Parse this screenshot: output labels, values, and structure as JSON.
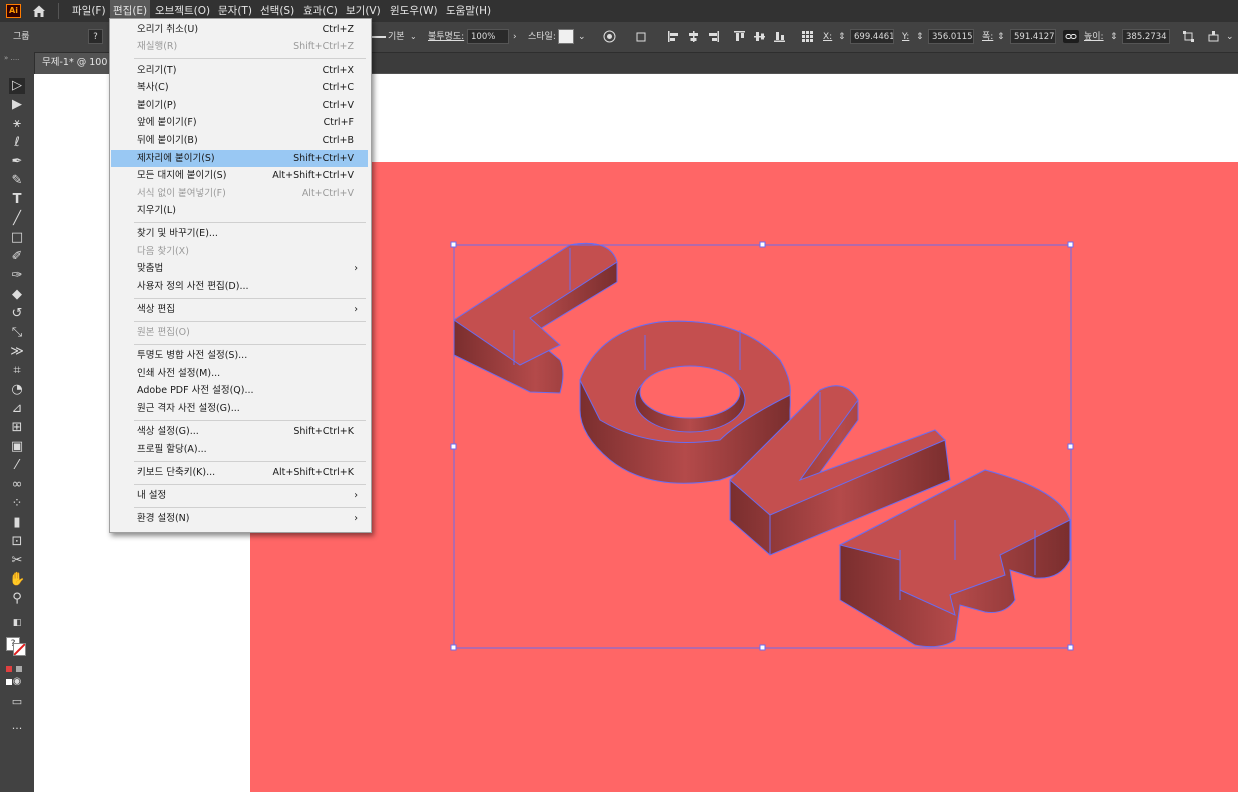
{
  "menubar": {
    "logo": "Ai",
    "items": [
      "파일(F)",
      "편집(E)",
      "오브젝트(O)",
      "문자(T)",
      "선택(S)",
      "효과(C)",
      "보기(V)",
      "윈도우(W)",
      "도움말(H)"
    ]
  },
  "controlbar": {
    "group_label": "그룹",
    "unknown_symbol": "?",
    "stroke_label": "기본",
    "opacity_label": "불투명도:",
    "opacity_value": "100%",
    "style_label": "스타일:",
    "x_label": "X:",
    "x_value": "699.4461 p",
    "y_label": "Y:",
    "y_value": "356.0115 p",
    "w_label": "폭:",
    "w_value": "591.4127 p",
    "h_label": "높이:",
    "h_value": "385.2734 p"
  },
  "document": {
    "tab_title": "무제-1* @ 100"
  },
  "edit_menu": {
    "items": [
      {
        "label": "오리기 취소(U)",
        "shortcut": "Ctrl+Z",
        "disabled": false
      },
      {
        "label": "재실행(R)",
        "shortcut": "Shift+Ctrl+Z",
        "disabled": true
      },
      {
        "label": "오리기(T)",
        "shortcut": "Ctrl+X",
        "disabled": false
      },
      {
        "label": "복사(C)",
        "shortcut": "Ctrl+C",
        "disabled": false
      },
      {
        "label": "붙이기(P)",
        "shortcut": "Ctrl+V",
        "disabled": false
      },
      {
        "label": "앞에 붙이기(F)",
        "shortcut": "Ctrl+F",
        "disabled": false
      },
      {
        "label": "뒤에 붙이기(B)",
        "shortcut": "Ctrl+B",
        "disabled": false
      },
      {
        "label": "제자리에 붙이기(S)",
        "shortcut": "Shift+Ctrl+V",
        "disabled": false,
        "highlighted": true
      },
      {
        "label": "모든 대지에 붙이기(S)",
        "shortcut": "Alt+Shift+Ctrl+V",
        "disabled": false
      },
      {
        "label": "서식 없이 붙여넣기(F)",
        "shortcut": "Alt+Ctrl+V",
        "disabled": true
      },
      {
        "label": "지우기(L)",
        "shortcut": "",
        "disabled": false
      },
      {
        "label": "찾기 및 바꾸기(E)...",
        "shortcut": "",
        "disabled": false
      },
      {
        "label": "다음 찾기(X)",
        "shortcut": "",
        "disabled": true
      },
      {
        "label": "맞춤법",
        "shortcut": "",
        "disabled": false,
        "submenu": true
      },
      {
        "label": "사용자 정의 사전 편집(D)...",
        "shortcut": "",
        "disabled": false
      },
      {
        "label": "색상 편집",
        "shortcut": "",
        "disabled": false,
        "submenu": true
      },
      {
        "label": "원본 편집(O)",
        "shortcut": "",
        "disabled": true
      },
      {
        "label": "투명도 병합 사전 설정(S)...",
        "shortcut": "",
        "disabled": false
      },
      {
        "label": "인쇄 사전 설정(M)...",
        "shortcut": "",
        "disabled": false
      },
      {
        "label": "Adobe PDF 사전 설정(Q)...",
        "shortcut": "",
        "disabled": false
      },
      {
        "label": "원근 격자 사전 설정(G)...",
        "shortcut": "",
        "disabled": false
      },
      {
        "label": "색상 설정(G)...",
        "shortcut": "Shift+Ctrl+K",
        "disabled": false
      },
      {
        "label": "프로필 할당(A)...",
        "shortcut": "",
        "disabled": false
      },
      {
        "label": "키보드 단축키(K)...",
        "shortcut": "Alt+Shift+Ctrl+K",
        "disabled": false
      },
      {
        "label": "내 설정",
        "shortcut": "",
        "disabled": false,
        "submenu": true
      },
      {
        "label": "환경 설정(N)",
        "shortcut": "",
        "disabled": false,
        "submenu": true
      }
    ],
    "submenu_arrow": "›"
  },
  "colors": {
    "artboard": "#ff6666",
    "extrude_side": "#8f3a3a",
    "face": "#d45454",
    "selection": "#6a6cf0",
    "menu_highlight": "#99c8f3"
  },
  "toolbox": {
    "more_tools": "..."
  }
}
